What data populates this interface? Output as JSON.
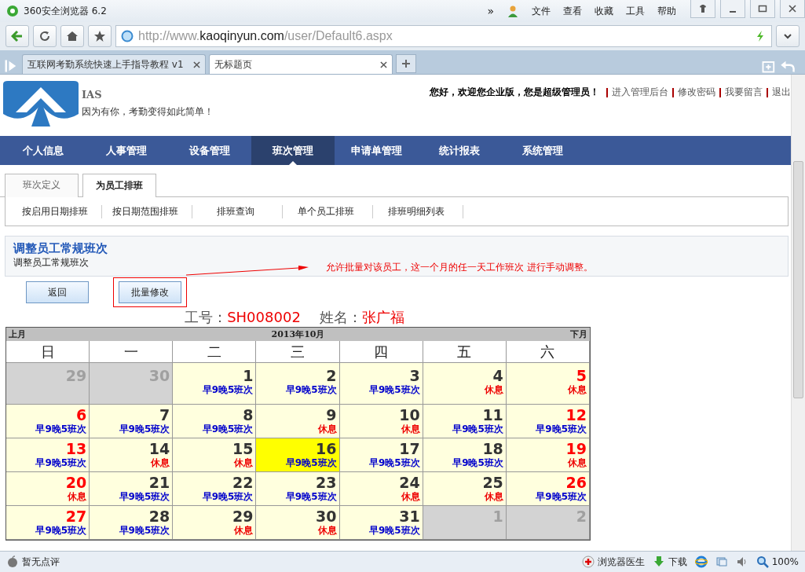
{
  "window": {
    "title": "360安全浏览器 6.2",
    "more": "»",
    "menu": [
      "文件",
      "查看",
      "收藏",
      "工具",
      "帮助"
    ]
  },
  "address": {
    "value_host": "http://www.",
    "value_domain": "kaoqinyun.com",
    "value_path": "/user/Default6.aspx"
  },
  "browser_tabs": [
    {
      "label": "互联网考勤系统快速上手指导教程 v1",
      "selected": false
    },
    {
      "label": "无标题页",
      "selected": true
    }
  ],
  "site": {
    "logo_text": "IAS",
    "slogan": "因为有你，考勤变得如此简单！",
    "greeting": "您好，欢迎您企业版，您是超级管理员！",
    "links": [
      "进入管理后台",
      "修改密码",
      "我要留言",
      "退出"
    ]
  },
  "nav": [
    {
      "label": "个人信息",
      "selected": false
    },
    {
      "label": "人事管理",
      "selected": false
    },
    {
      "label": "设备管理",
      "selected": false
    },
    {
      "label": "班次管理",
      "selected": true
    },
    {
      "label": "申请单管理",
      "selected": false
    },
    {
      "label": "统计报表",
      "selected": false
    },
    {
      "label": "系统管理",
      "selected": false
    }
  ],
  "tabs": [
    {
      "label": "班次定义",
      "selected": false
    },
    {
      "label": "为员工排班",
      "selected": true
    }
  ],
  "sub_links": [
    "按启用日期排班",
    "按日期范围排班",
    "排班查询",
    "单个员工排班",
    "排班明细列表"
  ],
  "panel": {
    "title": "调整员工常规班次",
    "subtitle": "调整员工常规班次"
  },
  "annotation": "允许批量对该员工，这一个月的任一天工作班次 进行手动调整。",
  "buttons": [
    {
      "label": "返回",
      "highlighted": false
    },
    {
      "label": "批量修改",
      "highlighted": true
    }
  ],
  "employee": {
    "id_label": "工号：",
    "id": "SH008002",
    "name_label": "姓名：",
    "name": "张广福"
  },
  "calendar": {
    "prev": "上月",
    "title": "2013年10月",
    "next": "下月",
    "weekdays": [
      "日",
      "一",
      "二",
      "三",
      "四",
      "五",
      "六"
    ],
    "days": [
      {
        "day": "29",
        "other_month": true,
        "weekend": false,
        "today": false,
        "kind": "none"
      },
      {
        "day": "30",
        "other_month": true,
        "weekend": false,
        "today": false,
        "kind": "none"
      },
      {
        "day": "1",
        "other_month": false,
        "weekend": false,
        "today": false,
        "kind": "work",
        "shift": "早9晚5班次"
      },
      {
        "day": "2",
        "other_month": false,
        "weekend": false,
        "today": false,
        "kind": "work",
        "shift": "早9晚5班次"
      },
      {
        "day": "3",
        "other_month": false,
        "weekend": false,
        "today": false,
        "kind": "work",
        "shift": "早9晚5班次"
      },
      {
        "day": "4",
        "other_month": false,
        "weekend": false,
        "today": false,
        "kind": "rest",
        "shift": "休息"
      },
      {
        "day": "5",
        "other_month": false,
        "weekend": true,
        "today": false,
        "kind": "rest",
        "shift": "休息"
      },
      {
        "day": "6",
        "other_month": false,
        "weekend": true,
        "today": false,
        "kind": "work",
        "shift": "早9晚5班次"
      },
      {
        "day": "7",
        "other_month": false,
        "weekend": false,
        "today": false,
        "kind": "work",
        "shift": "早9晚5班次"
      },
      {
        "day": "8",
        "other_month": false,
        "weekend": false,
        "today": false,
        "kind": "work",
        "shift": "早9晚5班次"
      },
      {
        "day": "9",
        "other_month": false,
        "weekend": false,
        "today": false,
        "kind": "rest",
        "shift": "休息"
      },
      {
        "day": "10",
        "other_month": false,
        "weekend": false,
        "today": false,
        "kind": "rest",
        "shift": "休息"
      },
      {
        "day": "11",
        "other_month": false,
        "weekend": false,
        "today": false,
        "kind": "work",
        "shift": "早9晚5班次"
      },
      {
        "day": "12",
        "other_month": false,
        "weekend": true,
        "today": false,
        "kind": "work",
        "shift": "早9晚5班次"
      },
      {
        "day": "13",
        "other_month": false,
        "weekend": true,
        "today": false,
        "kind": "work",
        "shift": "早9晚5班次"
      },
      {
        "day": "14",
        "other_month": false,
        "weekend": false,
        "today": false,
        "kind": "rest",
        "shift": "休息"
      },
      {
        "day": "15",
        "other_month": false,
        "weekend": false,
        "today": false,
        "kind": "rest",
        "shift": "休息"
      },
      {
        "day": "16",
        "other_month": false,
        "weekend": false,
        "today": true,
        "kind": "work",
        "shift": "早9晚5班次"
      },
      {
        "day": "17",
        "other_month": false,
        "weekend": false,
        "today": false,
        "kind": "work",
        "shift": "早9晚5班次"
      },
      {
        "day": "18",
        "other_month": false,
        "weekend": false,
        "today": false,
        "kind": "work",
        "shift": "早9晚5班次"
      },
      {
        "day": "19",
        "other_month": false,
        "weekend": true,
        "today": false,
        "kind": "rest",
        "shift": "休息"
      },
      {
        "day": "20",
        "other_month": false,
        "weekend": true,
        "today": false,
        "kind": "rest",
        "shift": "休息"
      },
      {
        "day": "21",
        "other_month": false,
        "weekend": false,
        "today": false,
        "kind": "work",
        "shift": "早9晚5班次"
      },
      {
        "day": "22",
        "other_month": false,
        "weekend": false,
        "today": false,
        "kind": "work",
        "shift": "早9晚5班次"
      },
      {
        "day": "23",
        "other_month": false,
        "weekend": false,
        "today": false,
        "kind": "work",
        "shift": "早9晚5班次"
      },
      {
        "day": "24",
        "other_month": false,
        "weekend": false,
        "today": false,
        "kind": "rest",
        "shift": "休息"
      },
      {
        "day": "25",
        "other_month": false,
        "weekend": false,
        "today": false,
        "kind": "rest",
        "shift": "休息"
      },
      {
        "day": "26",
        "other_month": false,
        "weekend": true,
        "today": false,
        "kind": "work",
        "shift": "早9晚5班次"
      },
      {
        "day": "27",
        "other_month": false,
        "weekend": true,
        "today": false,
        "kind": "work",
        "shift": "早9晚5班次"
      },
      {
        "day": "28",
        "other_month": false,
        "weekend": false,
        "today": false,
        "kind": "work",
        "shift": "早9晚5班次"
      },
      {
        "day": "29",
        "other_month": false,
        "weekend": false,
        "today": false,
        "kind": "rest",
        "shift": "休息"
      },
      {
        "day": "30",
        "other_month": false,
        "weekend": false,
        "today": false,
        "kind": "rest",
        "shift": "休息"
      },
      {
        "day": "31",
        "other_month": false,
        "weekend": false,
        "today": false,
        "kind": "work",
        "shift": "早9晚5班次"
      },
      {
        "day": "1",
        "other_month": true,
        "weekend": false,
        "today": false,
        "kind": "none"
      },
      {
        "day": "2",
        "other_month": true,
        "weekend": false,
        "today": false,
        "kind": "none"
      }
    ]
  },
  "status_bar": {
    "review": "暂无点评",
    "doctor": "浏览器医生",
    "download": "下载",
    "zoom": "100%"
  }
}
